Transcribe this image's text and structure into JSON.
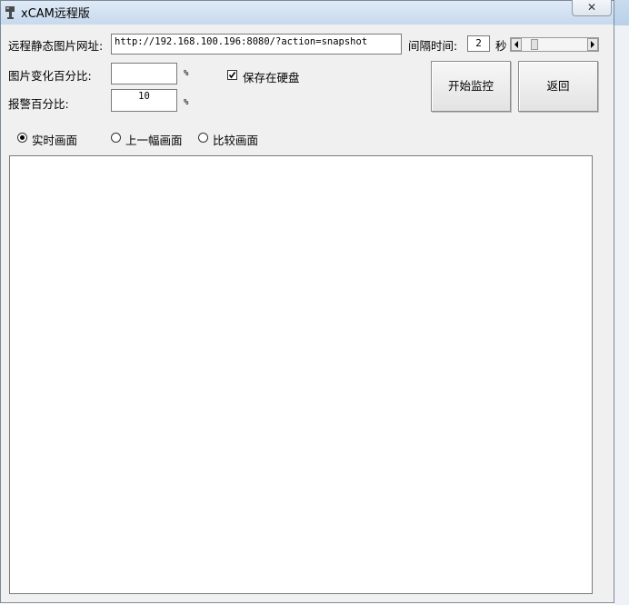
{
  "window": {
    "title": "xCAM远程版",
    "close_label": "✕"
  },
  "form": {
    "url_label": "远程静态图片网址:",
    "url_value": "http://192.168.100.196:8080/?action=snapshot",
    "interval_label": "间隔时间:",
    "interval_value": "2",
    "interval_unit": "秒",
    "change_percent_label": "图片变化百分比:",
    "change_percent_value": "",
    "change_percent_unit": "%",
    "alarm_percent_label": "报警百分比:",
    "alarm_percent_value": "10",
    "alarm_percent_unit": "%",
    "save_to_disk_label": "保存在硬盘",
    "save_to_disk_checked": true
  },
  "buttons": {
    "start_monitor": "开始监控",
    "back": "返回"
  },
  "view_modes": {
    "selected": "realtime",
    "options": [
      {
        "id": "realtime",
        "label": "实时画面"
      },
      {
        "id": "previous",
        "label": "上一幅画面"
      },
      {
        "id": "compare",
        "label": "比较画面"
      }
    ]
  },
  "icons": {
    "close": "close-icon",
    "checkbox": "check-icon",
    "left": "arrow-left-icon",
    "right": "arrow-right-icon"
  }
}
